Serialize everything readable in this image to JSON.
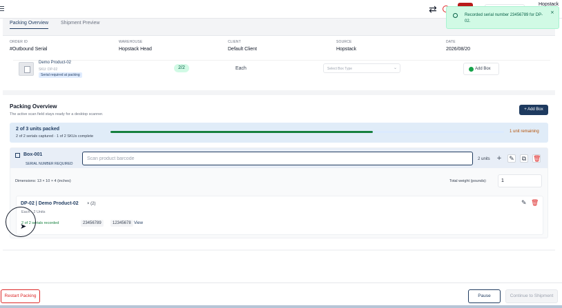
{
  "header": {
    "user_text": "Hopstack"
  },
  "toast": {
    "message": "Recorded serial number 23456789 for DP-02.",
    "close": "×"
  },
  "tabs": [
    {
      "label": "Packing Overview",
      "active": true
    },
    {
      "label": "Shipment Preview",
      "active": false
    }
  ],
  "order": {
    "fields": [
      {
        "label": "ORDER ID",
        "value": "#Outbound Serial"
      },
      {
        "label": "WAREHOUSE",
        "value": "Hopstack Head"
      },
      {
        "label": "CLIENT",
        "value": "Default Client"
      },
      {
        "label": "SOURCE",
        "value": "Hopstack"
      },
      {
        "label": "DATE",
        "value": "2026/08/20"
      }
    ],
    "product": {
      "name": "Demo Product-02",
      "sku": "SKU: DP-02",
      "badge": "Serial required at packing",
      "qty": "2/2",
      "uom": "Each",
      "box_select_placeholder": "Select Box Type",
      "add_box_label": "Add Box"
    }
  },
  "packing": {
    "title": "Packing Overview",
    "subtitle": "The active scan field stays ready for a desktop scanner.",
    "add_box_button": "+ Add Box",
    "progress": {
      "title": "2 of 3 units packed",
      "subtitle": "2 of 2 serials captured · 1 of 2 SKUs complete",
      "fraction": 0.6667,
      "remaining": "1 unit remaining"
    },
    "box": {
      "name": "Box-001",
      "requirement": "SERIAL NUMBER REQUIRED",
      "scan_placeholder": "Scan product barcode",
      "units": "2 units",
      "dimensions": "Dimensions: 13 × 10 × 4 (inches)",
      "weight_label": "Total weight (pounds):",
      "weight_value": "1",
      "line_item": {
        "title": "DP-02 | Demo Product-02",
        "qty": "× (2)",
        "uom_line": "Each · 2 Units",
        "serials_status": "2 of 2 serials recorded",
        "serials": [
          "23456789",
          "12345678"
        ],
        "view_label": "View"
      }
    }
  },
  "footer": {
    "restart": "Restart Packing",
    "pause": "Pause",
    "continue": "Continue to Shipment"
  },
  "colors": {
    "primary": "#1e3a5f",
    "success": "#15803d",
    "danger": "#dc2626",
    "warning": "#b45309"
  }
}
